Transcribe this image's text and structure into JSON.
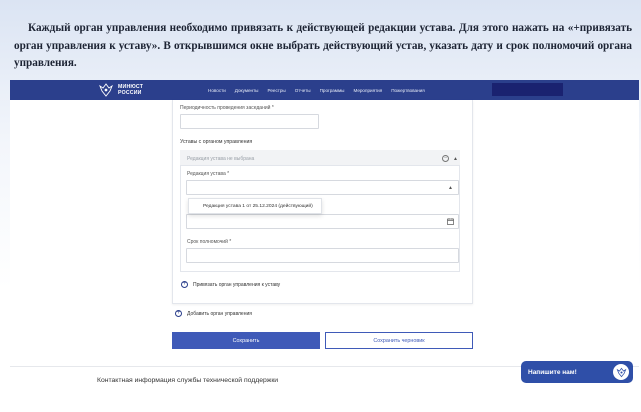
{
  "instruction": {
    "text": "Каждый орган управления необходимо привязать к действующей редакции устава. Для этого нажать на «+привязать орган управления к уставу». В открывшимся окне выбрать действующий устав, указать дату и срок полномочий органа управления."
  },
  "header": {
    "logo_line1": "МИНЮСТ",
    "logo_line2": "РОССИИ",
    "nav": [
      "Новости",
      "Документы",
      "Реестры",
      "Отчеты",
      "Программы",
      "Мероприятия",
      "Пожертвования"
    ],
    "colors": {
      "nav_bg": "#2b3f8c",
      "user_block": "#1a2270"
    }
  },
  "form": {
    "meeting_frequency_label": "Периодичность проведения заседаний *",
    "meeting_frequency_value": "",
    "charters_section_title": "Уставы с органом управления",
    "charter_panel_placeholder": "Редакция устава не выбрана",
    "charter_edition_label": "Редакция устава *",
    "charter_edition_value": "",
    "charter_option": "Редакция устава 1 от 25.12.2024 (действующий)",
    "date_value": "",
    "term_label": "Срок полномочий *",
    "term_value": "",
    "link_charter_text": "Привязать орган управления к уставу",
    "add_body_text": "Добавить орган управления"
  },
  "actions": {
    "save_label": "Сохранить",
    "save_draft_label": "Сохранить черновик",
    "primary_color": "#3f5ab8"
  },
  "footer": {
    "support_text": "Контактная информация службы технической поддержки"
  },
  "chat": {
    "label": "Напишите нам!",
    "color": "#2f4fa8"
  },
  "icons": [
    "eagle-logo-icon",
    "minus-circle-icon",
    "caret-up-icon",
    "calendar-icon",
    "plus-circle-icon",
    "chat-avatar-icon"
  ]
}
